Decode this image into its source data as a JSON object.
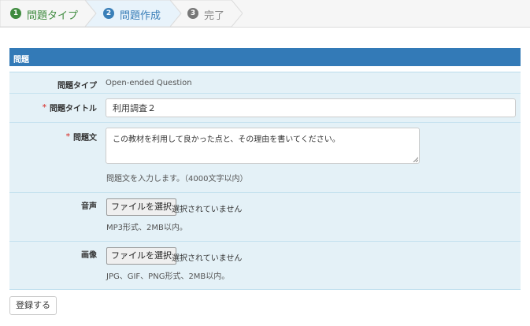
{
  "wizard": {
    "steps": [
      {
        "number": "1",
        "label": "問題タイプ",
        "state": "done"
      },
      {
        "number": "2",
        "label": "問題作成",
        "state": "active"
      },
      {
        "number": "3",
        "label": "完了",
        "state": "pending"
      }
    ]
  },
  "panel": {
    "title": "問題"
  },
  "form": {
    "type": {
      "label": "問題タイプ",
      "value": "Open-ended Question"
    },
    "title": {
      "required_mark": "*",
      "label": "問題タイトル",
      "value": "利用調査２"
    },
    "body": {
      "required_mark": "*",
      "label": "問題文",
      "value": "この教材を利用して良かった点と、その理由を書いてください。",
      "help": "問題文を入力します。（4000文字以内）"
    },
    "audio": {
      "label": "音声",
      "button": "ファイルを選択",
      "status": "選択されていません",
      "help": "MP3形式、2MB以内。"
    },
    "image": {
      "label": "画像",
      "button": "ファイルを選択",
      "status": "選択されていません",
      "help": "JPG、GIF、PNG形式、2MB以内。"
    }
  },
  "submit": {
    "label": "登録する"
  },
  "colors": {
    "primary": "#337ab7",
    "success": "#3f8b3f",
    "row_bg": "#e4f1f7",
    "required": "#d9534f"
  }
}
